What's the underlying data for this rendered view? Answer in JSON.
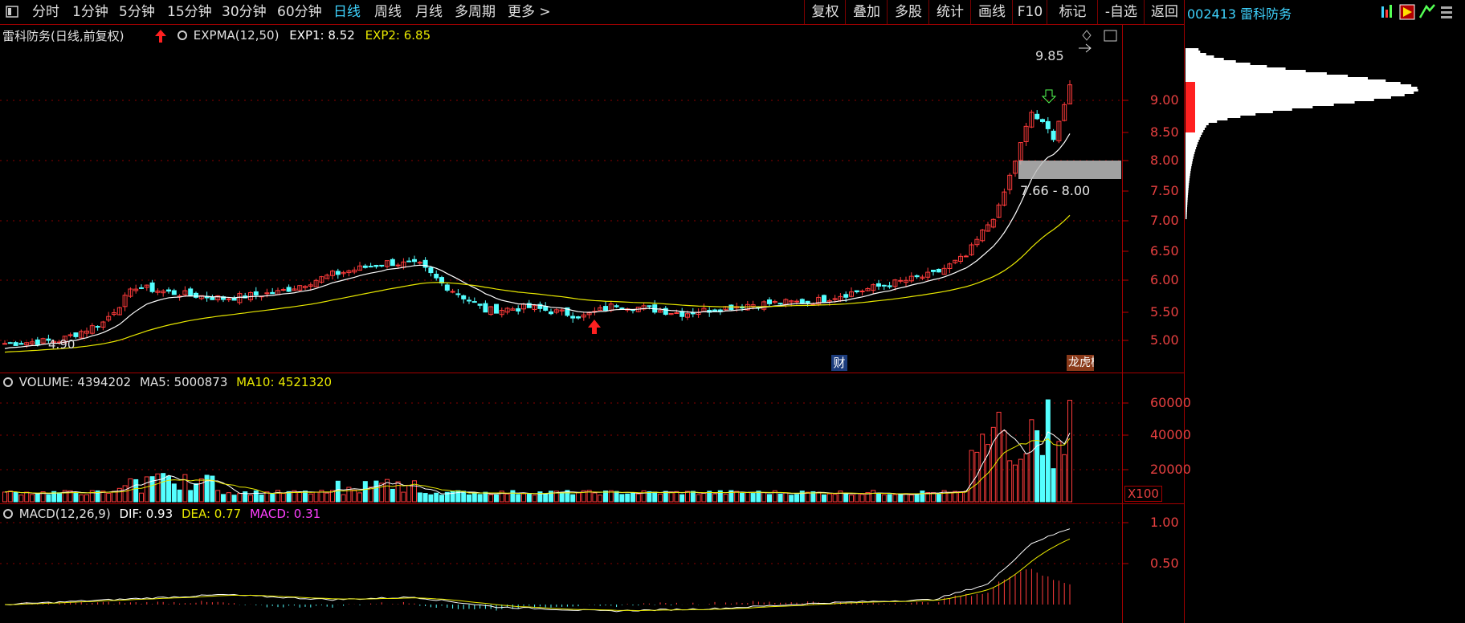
{
  "toolbar": {
    "tabs": [
      "分时",
      "1分钟",
      "5分钟",
      "15分钟",
      "30分钟",
      "60分钟",
      "日线",
      "周线",
      "月线",
      "多周期",
      "更多 >"
    ],
    "active_tab": "日线",
    "right_buttons": [
      "复权",
      "叠加",
      "多股",
      "统计",
      "画线",
      "F10",
      "标记",
      "-自选",
      "返回"
    ]
  },
  "stock": {
    "code": "002413",
    "name": "雷科防务"
  },
  "main_panel": {
    "title": "雷科防务(日线,前复权)",
    "indicator": "EXPMA(12,50)",
    "exp1_label": "EXP1: 8.52",
    "exp2_label": "EXP2: 6.85",
    "high_label": "9.85",
    "low_label": "4.90",
    "zone_label": "7.66 - 8.00",
    "marker_cai": "财",
    "marker_bang": "龙虎榜",
    "y_ticks": [
      "9.00",
      "8.50",
      "8.00",
      "7.50",
      "7.00",
      "6.50",
      "6.00",
      "5.50",
      "5.00"
    ]
  },
  "volume_panel": {
    "title": "VOLUME: 4394202",
    "ma5_label": "MA5: 5000873",
    "ma10_label": "MA10: 4521320",
    "y_ticks": [
      "60000",
      "40000",
      "20000"
    ],
    "unit": "X100"
  },
  "macd_panel": {
    "title": "MACD(12,26,9)",
    "dif_label": "DIF: 0.93",
    "dea_label": "DEA: 0.77",
    "macd_label": "MACD: 0.31",
    "y_ticks": [
      "1.00",
      "0.50"
    ]
  },
  "colors": {
    "up": "#ff3b3b",
    "down": "#54ffff",
    "exp1": "#ffffff",
    "exp2": "#e8e800",
    "macd_bar": "#ff3b3b",
    "accent": "#3fd4ff",
    "grid": "#a40000"
  },
  "chart_data": {
    "type": "candlestick",
    "series": [
      {
        "name": "EXP1",
        "values_end": 8.52
      },
      {
        "name": "EXP2",
        "values_end": 6.85
      },
      {
        "name": "VOLUME",
        "values_end": 4394202
      },
      {
        "name": "MA5",
        "values_end": 5000873
      },
      {
        "name": "MA10",
        "values_end": 4521320
      },
      {
        "name": "DIF",
        "values_end": 0.93
      },
      {
        "name": "DEA",
        "values_end": 0.77
      },
      {
        "name": "MACD",
        "values_end": 0.31
      }
    ],
    "price_ylim": [
      4.6,
      10.2
    ],
    "volume_ylim": [
      0,
      70000
    ],
    "macd_ylim": [
      -0.15,
      1.15
    ]
  }
}
